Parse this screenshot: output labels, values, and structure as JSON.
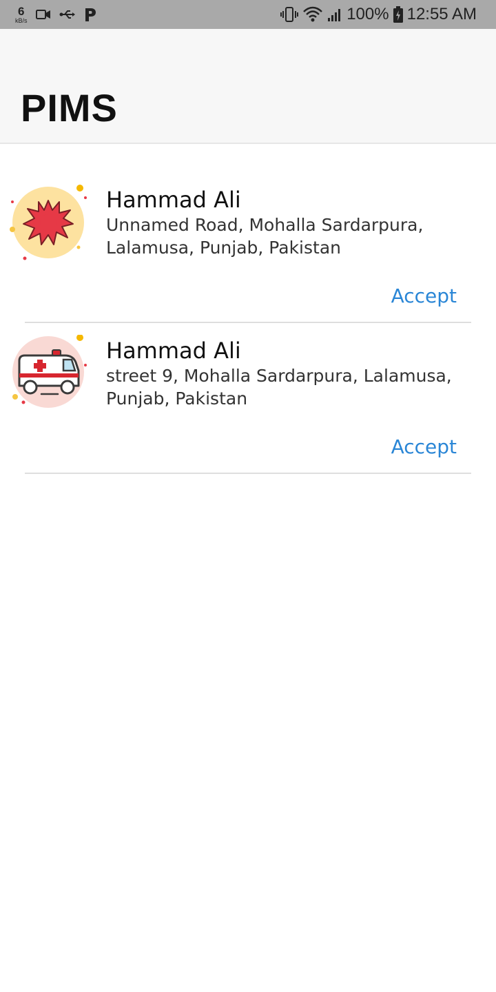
{
  "status_bar": {
    "speed_value": "6",
    "speed_unit": "kB/s",
    "battery": "100%",
    "time": "12:55 AM",
    "left_icons": [
      "video-icon",
      "usb-icon",
      "p-icon"
    ],
    "right_icons": [
      "vibrate-icon",
      "wifi-icon",
      "signal-icon",
      "battery-icon"
    ]
  },
  "app_bar": {
    "title": "PIMS"
  },
  "requests": [
    {
      "name": "Hammad Ali",
      "address": "Unnamed Road, Mohalla Sardarpura, Lalamusa, Punjab, Pakistan",
      "action_label": "Accept",
      "icon": "blood-splash-icon"
    },
    {
      "name": "Hammad Ali",
      "address": "street 9, Mohalla Sardarpura, Lalamusa, Punjab, Pakistan",
      "action_label": "Accept",
      "icon": "ambulance-icon"
    }
  ],
  "colors": {
    "status_bar_bg": "#a9a9a9",
    "app_bar_bg": "#f7f7f7",
    "accent": "#2a86d6",
    "splash_red": "#e63946",
    "splash_circle": "#fde2a0",
    "ambulance_circle": "#f9d9d4"
  }
}
